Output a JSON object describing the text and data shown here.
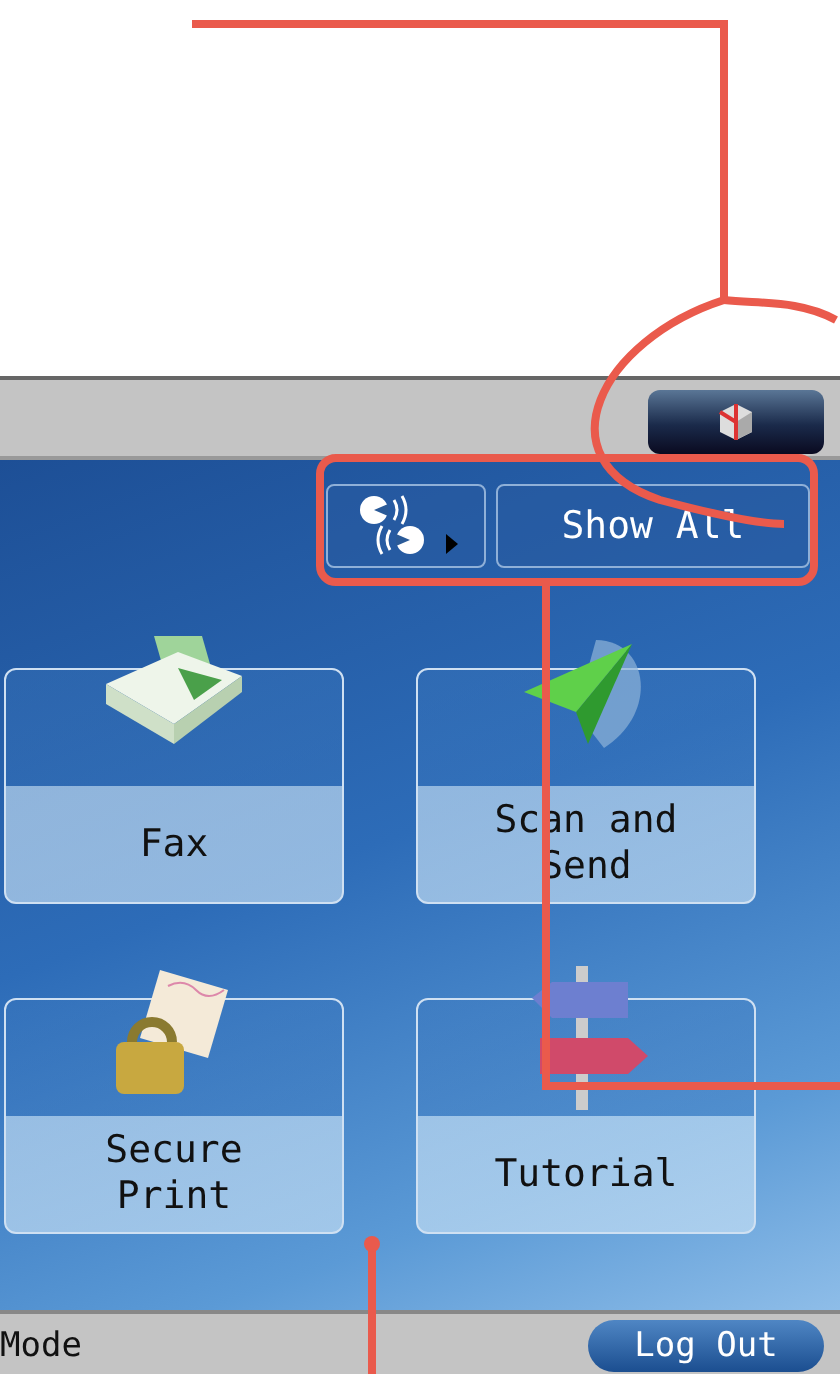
{
  "top_bar": {
    "status_button": {
      "kind": "cube"
    }
  },
  "shortcuts": {
    "show_all": "Show All"
  },
  "functions": [
    {
      "label": "Fax",
      "kind": "fax"
    },
    {
      "label": "Scan and Send",
      "kind": "send"
    },
    {
      "label": "Secure Print",
      "kind": "lock"
    },
    {
      "label": "Tutorial",
      "kind": "signpost"
    }
  ],
  "status_bar": {
    "mode": "Mode",
    "logout": "Log Out"
  }
}
